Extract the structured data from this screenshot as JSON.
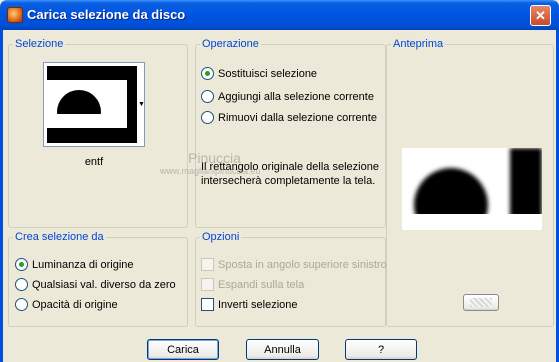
{
  "window": {
    "title": "Carica selezione da disco",
    "close_label": "✕"
  },
  "selezione": {
    "legend": "Selezione",
    "file_name": "entf"
  },
  "operazione": {
    "legend": "Operazione",
    "options": [
      {
        "label": "Sostituisci selezione",
        "checked": true
      },
      {
        "label": "Aggiungi alla selezione corrente",
        "checked": false
      },
      {
        "label": "Rimuovi dalla selezione corrente",
        "checked": false
      }
    ],
    "message_line1": "Il rettangolo originale della selezione",
    "message_line2": "intersecherà completamente la tela."
  },
  "anteprima": {
    "legend": "Anteprima"
  },
  "crea": {
    "legend": "Crea selezione da",
    "options": [
      {
        "label": "Luminanza di origine",
        "checked": true
      },
      {
        "label": "Qualsiasi val. diverso da zero",
        "checked": false
      },
      {
        "label": "Opacità di origine",
        "checked": false
      }
    ]
  },
  "opzioni": {
    "legend": "Opzioni",
    "items": [
      {
        "label": "Sposta in angolo superiore sinistro",
        "enabled": false,
        "checked": false
      },
      {
        "label": "Espandi sulla tela",
        "enabled": false,
        "checked": false
      },
      {
        "label": "Inverti selezione",
        "enabled": true,
        "checked": false
      }
    ]
  },
  "buttons": {
    "load": "Carica",
    "cancel": "Annulla",
    "help": "?"
  },
  "watermark": {
    "line1": "Pinuccia",
    "line2": "www.maglianipinuccia.eu"
  },
  "colors": {
    "title_bar": "#0054E3",
    "legend_text": "#0046D5",
    "dialog_bg": "#ECE9D8"
  }
}
